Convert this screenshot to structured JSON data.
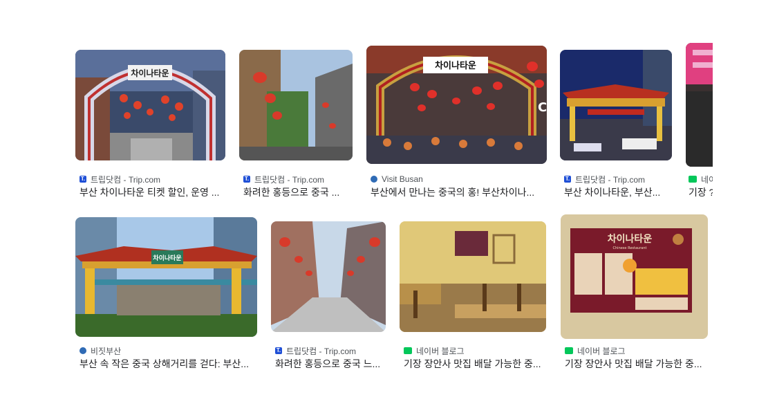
{
  "results": [
    {
      "source": "트립닷컴 - Trip.com",
      "title": "부산 차이나타운 티켓 할인, 운영 ...",
      "favicon": "trip-favicon",
      "sign": "차이나타운"
    },
    {
      "source": "트립닷컴 - Trip.com",
      "title": "화려한 홍등으로 중국 ...",
      "favicon": "trip-favicon"
    },
    {
      "source": "Visit Busan",
      "title": "부산에서 만나는 중국의 홍! 부산차이나...",
      "favicon": "visit-busan-favicon",
      "sign": "차이나타운"
    },
    {
      "source": "트립닷컴 - Trip.com",
      "title": "부산 차이나타운, 부산...",
      "favicon": "trip-favicon"
    },
    {
      "source": "네이",
      "title": "기장 ?",
      "favicon": "naver-favicon"
    },
    {
      "source": "비짓부산",
      "title": "부산 속 작은 중국 상해거리를 걷다: 부산...",
      "favicon": "visit-busan-favicon",
      "sign": "차이나타운"
    },
    {
      "source": "트립닷컴 - Trip.com",
      "title": "화려한 홍등으로 중국 느...",
      "favicon": "trip-favicon"
    },
    {
      "source": "네이버 블로그",
      "title": "기장 장안사 맛집 배달 가능한 중...",
      "favicon": "naver-favicon"
    },
    {
      "source": "네이버 블로그",
      "title": "기장 장안사 맛집 배달 가능한 중...",
      "favicon": "naver-favicon",
      "sign": "차이나타운",
      "sign_sub": "Chinese Restaurant"
    }
  ],
  "favicon_text": {
    "trip": "T.",
    "naver": "blog"
  }
}
